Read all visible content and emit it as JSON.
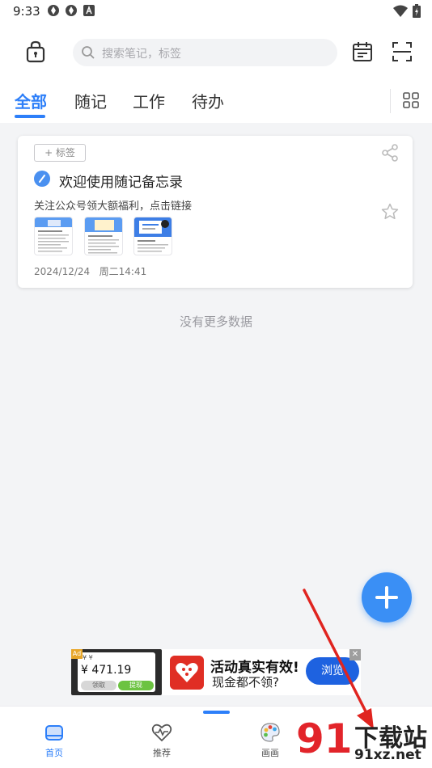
{
  "status_bar": {
    "time": "9:33"
  },
  "search": {
    "placeholder": "搜索笔记，标签"
  },
  "tabs": [
    {
      "label": "全部",
      "active": true
    },
    {
      "label": "随记",
      "active": false
    },
    {
      "label": "工作",
      "active": false
    },
    {
      "label": "待办",
      "active": false
    }
  ],
  "note": {
    "tag_button": "+ 标签",
    "title": "欢迎使用随记备忘录",
    "subtitle": "关注公众号领大额福利，点击链接",
    "date": "2024/12/24",
    "time": "周二14:41"
  },
  "empty_text": "没有更多数据",
  "ad": {
    "left_amount": "¥ 471.19",
    "left_btn_a": "领取",
    "left_btn_b": "提现",
    "title": "活动真实有效!",
    "subtitle": "现金都不领?",
    "button": "浏览"
  },
  "bottom_nav": [
    {
      "label": "首页",
      "active": true
    },
    {
      "label": "推荐",
      "active": false
    },
    {
      "label": "画画",
      "active": false
    }
  ],
  "watermark": {
    "brand": "91",
    "text": "下载站",
    "url": "91xz.net"
  },
  "colors": {
    "accent": "#2d7ff9",
    "fab": "#3a8ff5",
    "arrow": "#e0241f"
  }
}
